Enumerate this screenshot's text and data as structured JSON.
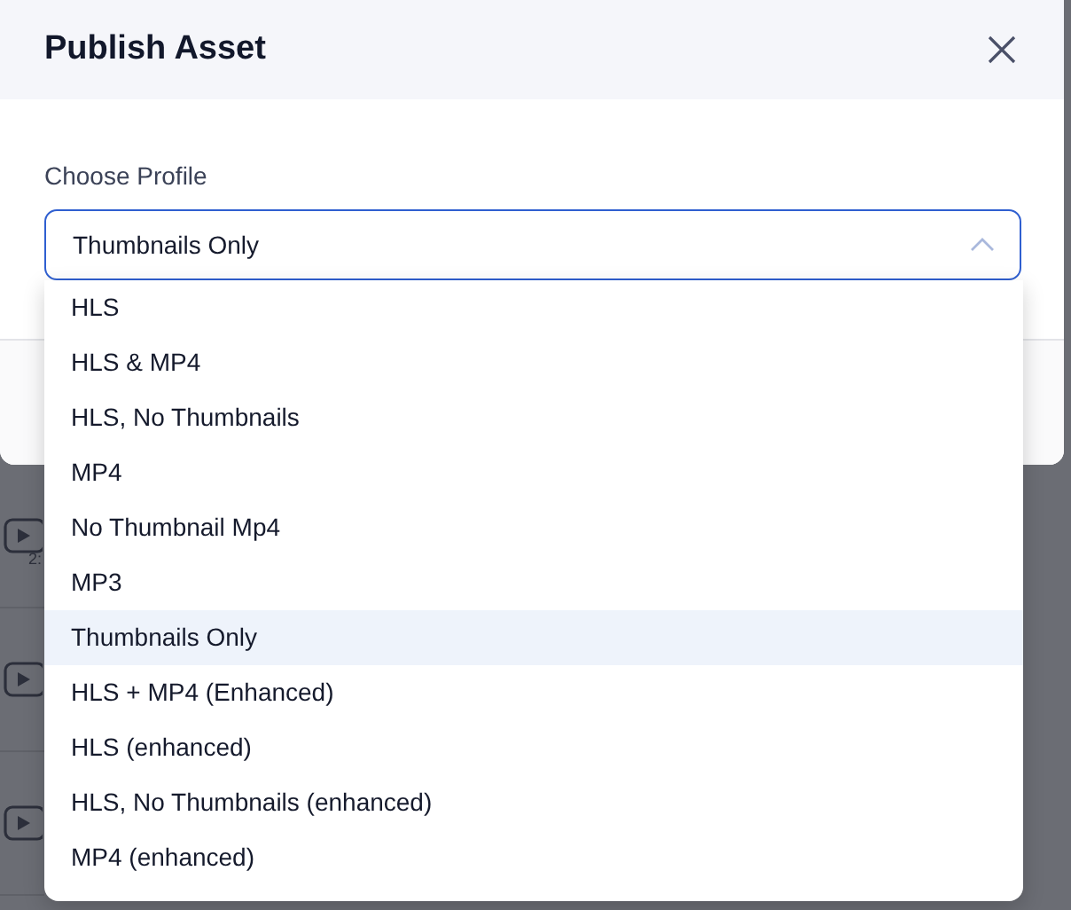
{
  "dialog": {
    "title": "Publish Asset",
    "field_label": "Choose Profile",
    "field_value": "Thumbnails Only",
    "expanded": true
  },
  "options": [
    {
      "label": "HLS",
      "selected": false
    },
    {
      "label": "HLS & MP4",
      "selected": false
    },
    {
      "label": "HLS, No Thumbnails",
      "selected": false
    },
    {
      "label": "MP4",
      "selected": false
    },
    {
      "label": "No Thumbnail Mp4",
      "selected": false
    },
    {
      "label": "MP3",
      "selected": false
    },
    {
      "label": "Thumbnails Only",
      "selected": true
    },
    {
      "label": "HLS + MP4 (Enhanced)",
      "selected": false
    },
    {
      "label": "HLS (enhanced)",
      "selected": false
    },
    {
      "label": "HLS, No Thumbnails (enhanced)",
      "selected": false
    },
    {
      "label": "MP4 (enhanced)",
      "selected": false
    }
  ],
  "background_rows": [
    {
      "duration": "2:"
    },
    {},
    {}
  ]
}
